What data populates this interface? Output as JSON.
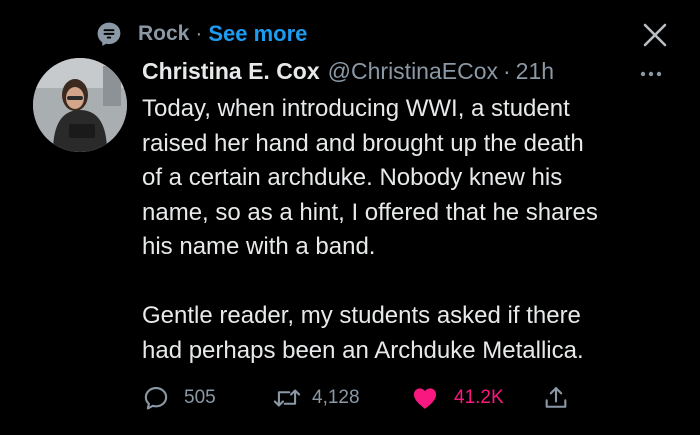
{
  "topic": {
    "label": "Rock",
    "separator": "·",
    "see_more": "See more"
  },
  "tweet": {
    "author_name": "Christina E. Cox",
    "handle": "@ChristinaECox",
    "separator": "·",
    "time": "21h",
    "text": "Today, when introducing WWI, a student\nraised her hand and brought up the death\nof a certain archduke. Nobody knew his\nname, so as a hint, I offered that he shares\nhis name with a band.\n\nGentle reader, my students asked if there\nhad perhaps been an Archduke Metallica."
  },
  "actions": {
    "replies": "505",
    "retweets": "4,128",
    "likes": "41.2K"
  },
  "colors": {
    "accent": "#1d9bf0",
    "like": "#f91880",
    "muted": "#8b98a5"
  },
  "icons": [
    "topic-icon",
    "close-icon",
    "more-icon",
    "reply-icon",
    "retweet-icon",
    "like-icon",
    "share-icon"
  ]
}
